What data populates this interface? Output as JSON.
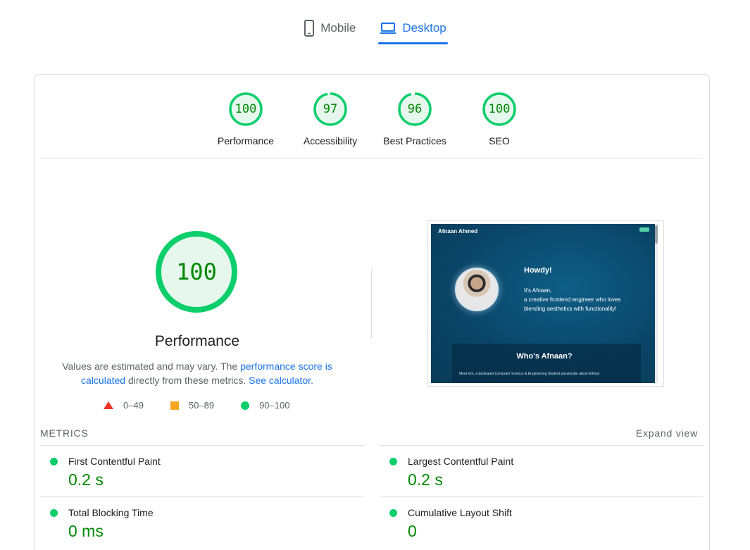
{
  "tabs": [
    {
      "label": "Mobile",
      "icon": "mobile-phone-icon",
      "active": false
    },
    {
      "label": "Desktop",
      "icon": "laptop-icon",
      "active": true
    }
  ],
  "category_scores": [
    {
      "score": "100",
      "label": "Performance",
      "value": 100
    },
    {
      "score": "97",
      "label": "Accessibility",
      "value": 97
    },
    {
      "score": "96",
      "label": "Best Practices",
      "value": 96
    },
    {
      "score": "100",
      "label": "SEO",
      "value": 100
    }
  ],
  "performance": {
    "score": "100",
    "value": 100,
    "title": "Performance",
    "desc_part1": "Values are estimated and may vary. The ",
    "desc_link1": "performance score is calculated",
    "desc_part2": " directly from these metrics. ",
    "desc_link2": "See calculator.",
    "legend": [
      {
        "range": "0–49",
        "color": "#eb3223",
        "shape": "triangle"
      },
      {
        "range": "50–89",
        "color": "#f5a623",
        "shape": "square"
      },
      {
        "range": "90–100",
        "color": "#0cce6b",
        "shape": "circle"
      }
    ]
  },
  "screenshot": {
    "brand": "Afnaan Ahmed",
    "heading": "Howdy!",
    "line1": "It's Afnaan,",
    "line2": "a creative frontend engineer who loves",
    "line3": "blending aesthetics with functionality!",
    "section_title": "Who's Afnaan?",
    "section_text": "Meet him, a dedicated Computer Science & Engineering Student passionate about Ethical"
  },
  "metrics": {
    "heading": "METRICS",
    "expand_label": "Expand view",
    "items": [
      {
        "name": "First Contentful Paint",
        "value": "0.2 s"
      },
      {
        "name": "Largest Contentful Paint",
        "value": "0.2 s"
      },
      {
        "name": "Total Blocking Time",
        "value": "0 ms"
      },
      {
        "name": "Cumulative Layout Shift",
        "value": "0"
      }
    ]
  },
  "colors": {
    "pass": "#0cce6b",
    "pass_text": "#008800",
    "accent": "#1a73e8"
  }
}
